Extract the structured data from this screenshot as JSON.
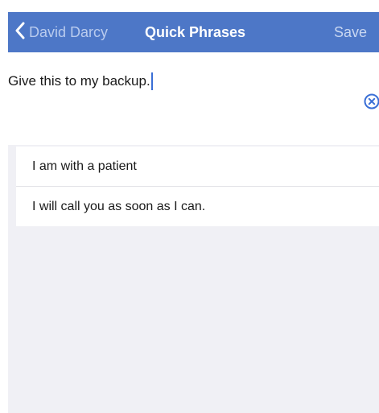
{
  "navbar": {
    "back_label": "David Darcy",
    "title": "Quick Phrases",
    "save_label": "Save"
  },
  "compose": {
    "text": "Give this to my backup."
  },
  "phrases": [
    {
      "label": "I am with a patient"
    },
    {
      "label": "I will call you as soon as I can."
    }
  ],
  "icons": {
    "back": "chevron-left-icon",
    "clear": "clear-circle-icon"
  },
  "colors": {
    "navbar_bg": "#4d77c7",
    "accent": "#3a6fd6",
    "screen_bg": "#f0f0f5"
  }
}
